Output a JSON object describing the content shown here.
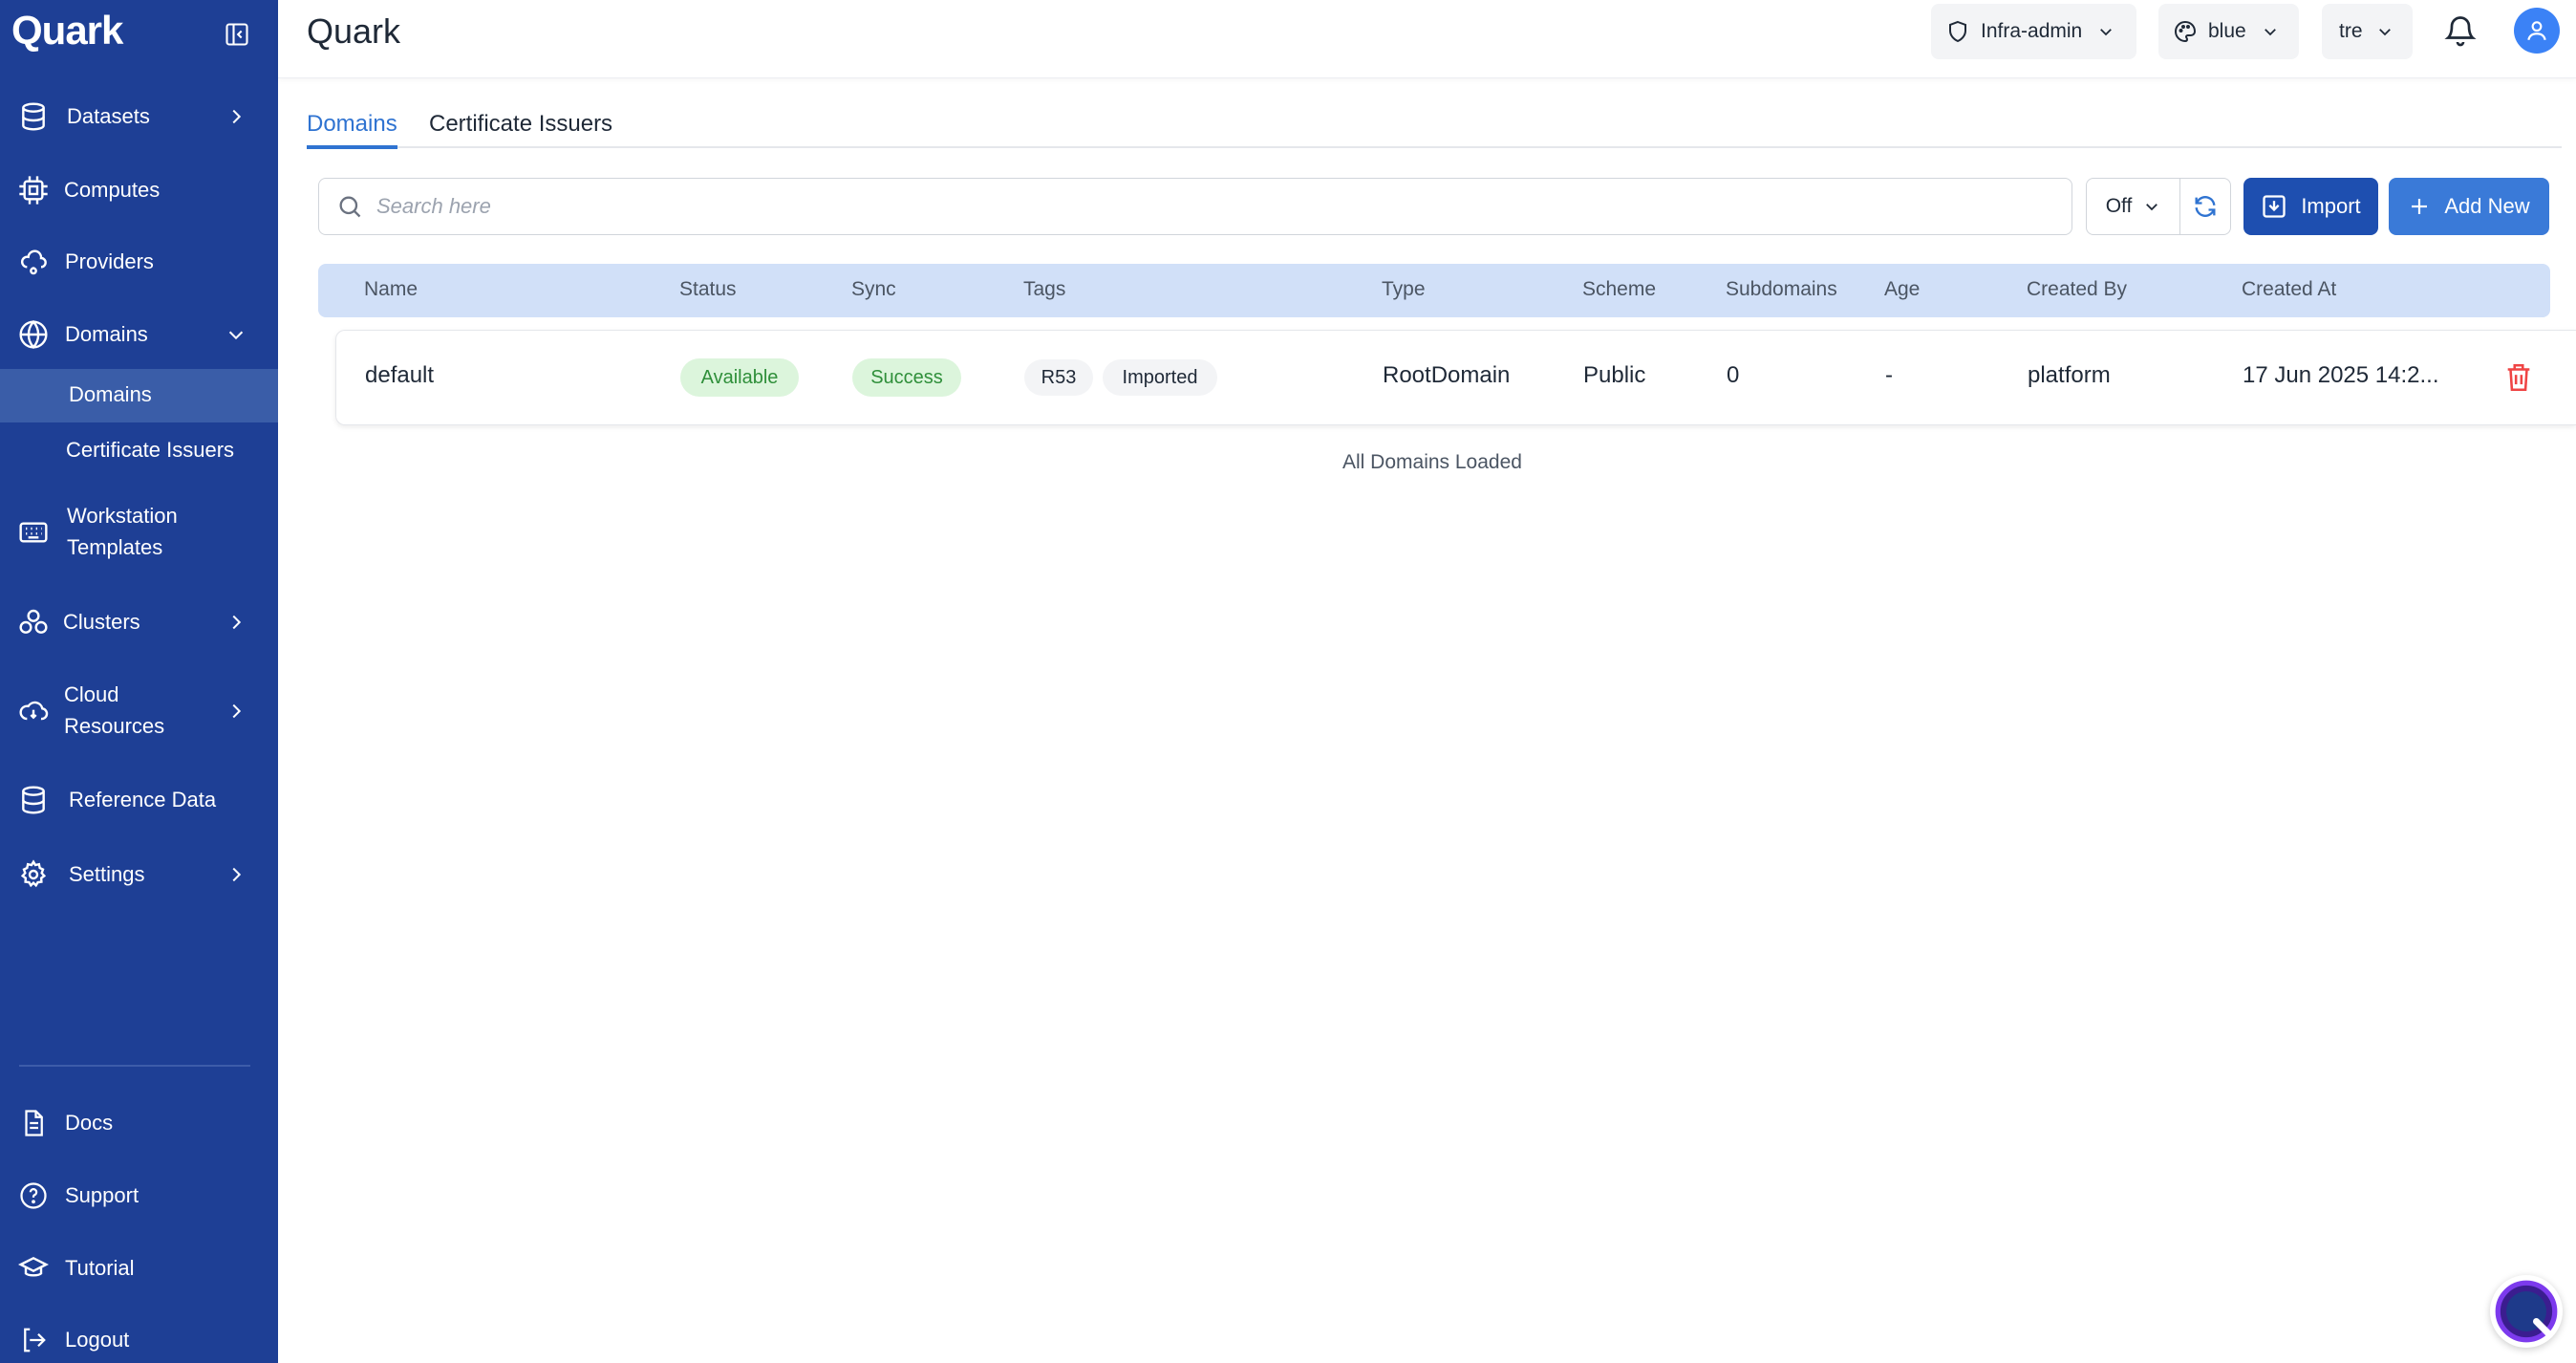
{
  "app": {
    "brand": "Quark",
    "page_title": "Quark"
  },
  "sidebar": {
    "items": [
      {
        "label": "Datasets",
        "icon": "database-icon"
      },
      {
        "label": "Computes",
        "icon": "cpu-icon"
      },
      {
        "label": "Providers",
        "icon": "cloud-network-icon"
      },
      {
        "label": "Domains",
        "icon": "globe-icon"
      },
      {
        "label": "Workstation Templates",
        "icon": "keyboard-icon"
      },
      {
        "label": "Clusters",
        "icon": "cluster-icon"
      },
      {
        "label": "Cloud Resources",
        "icon": "cloud-icon"
      },
      {
        "label": "Reference Data",
        "icon": "database-icon"
      },
      {
        "label": "Settings",
        "icon": "gear-icon"
      }
    ],
    "domains_sub": [
      "Domains",
      "Certificate Issuers"
    ],
    "footer": [
      {
        "label": "Docs",
        "icon": "document-icon"
      },
      {
        "label": "Support",
        "icon": "help-icon"
      },
      {
        "label": "Tutorial",
        "icon": "graduation-cap-icon"
      },
      {
        "label": "Logout",
        "icon": "logout-icon"
      }
    ]
  },
  "header": {
    "role": "Infra-admin",
    "theme": "blue",
    "tenant": "tre"
  },
  "tabs": [
    "Domains",
    "Certificate Issuers"
  ],
  "toolbar": {
    "search_placeholder": "Search here",
    "sync_value": "Off",
    "import_label": "Import",
    "add_label": "Add New"
  },
  "table": {
    "columns": [
      "Name",
      "Status",
      "Sync",
      "Tags",
      "Type",
      "Scheme",
      "Subdomains",
      "Age",
      "Created By",
      "Created At"
    ],
    "rows": [
      {
        "name": "default",
        "status": "Available",
        "sync": "Success",
        "tags": [
          "R53",
          "Imported"
        ],
        "type": "RootDomain",
        "scheme": "Public",
        "subdomains": "0",
        "age": "-",
        "created_by": "platform",
        "created_at": "17 Jun 2025 14:2..."
      }
    ],
    "footer_text": "All Domains Loaded"
  },
  "colors": {
    "sidebar_bg": "#1e3f95",
    "accent": "#2f73d1",
    "import_btn": "#1e4fb0",
    "add_btn": "#3a7ad8",
    "header_row": "#d1e0f8",
    "success_bg": "#dcf5dc",
    "danger": "#ef4444"
  }
}
